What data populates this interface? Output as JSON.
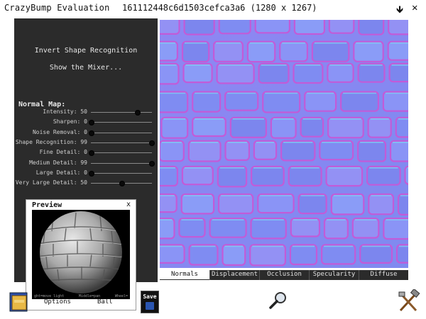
{
  "window": {
    "app_title": "CrazyBump Evaluation",
    "document_title": "161112448c6d1503cefca3a6 (1280 x 1267)"
  },
  "left_panel": {
    "invert_link": "Invert Shape Recognition",
    "mixer_link": "Show the Mixer...",
    "normal_map_heading": "Normal Map:",
    "sliders": [
      {
        "label": "Intensity: 50",
        "value": 75
      },
      {
        "label": "Sharpen: 0",
        "value": 0
      },
      {
        "label": "Noise Removal: 0",
        "value": 0
      },
      {
        "label": "Shape Recognition: 99",
        "value": 99
      },
      {
        "label": "Fine Detail: 0",
        "value": 0
      },
      {
        "label": "Medium Detail: 99",
        "value": 99
      },
      {
        "label": "Large Detail: 0",
        "value": 0
      },
      {
        "label": "Very Large Detail: 50",
        "value": 50
      }
    ]
  },
  "preview": {
    "title": "Preview",
    "close": "x",
    "hints": [
      "ght=move light",
      "Middle=pan",
      "Wheel="
    ],
    "options_label": "Options",
    "ball_label": "Ball"
  },
  "toolbar": {
    "save_label": "Save"
  },
  "tabs": [
    {
      "label": "Normals",
      "active": true
    },
    {
      "label": "Displacement",
      "active": false
    },
    {
      "label": "Occlusion",
      "active": false
    },
    {
      "label": "Specularity",
      "active": false
    },
    {
      "label": "Diffuse",
      "active": false
    }
  ],
  "icons": {
    "download": "download-arrow-icon",
    "close": "close-icon",
    "open": "open-folder-icon",
    "save_disk": "floppy-disk-icon",
    "magnifier": "magnifier-icon",
    "tools": "tools-icon"
  }
}
